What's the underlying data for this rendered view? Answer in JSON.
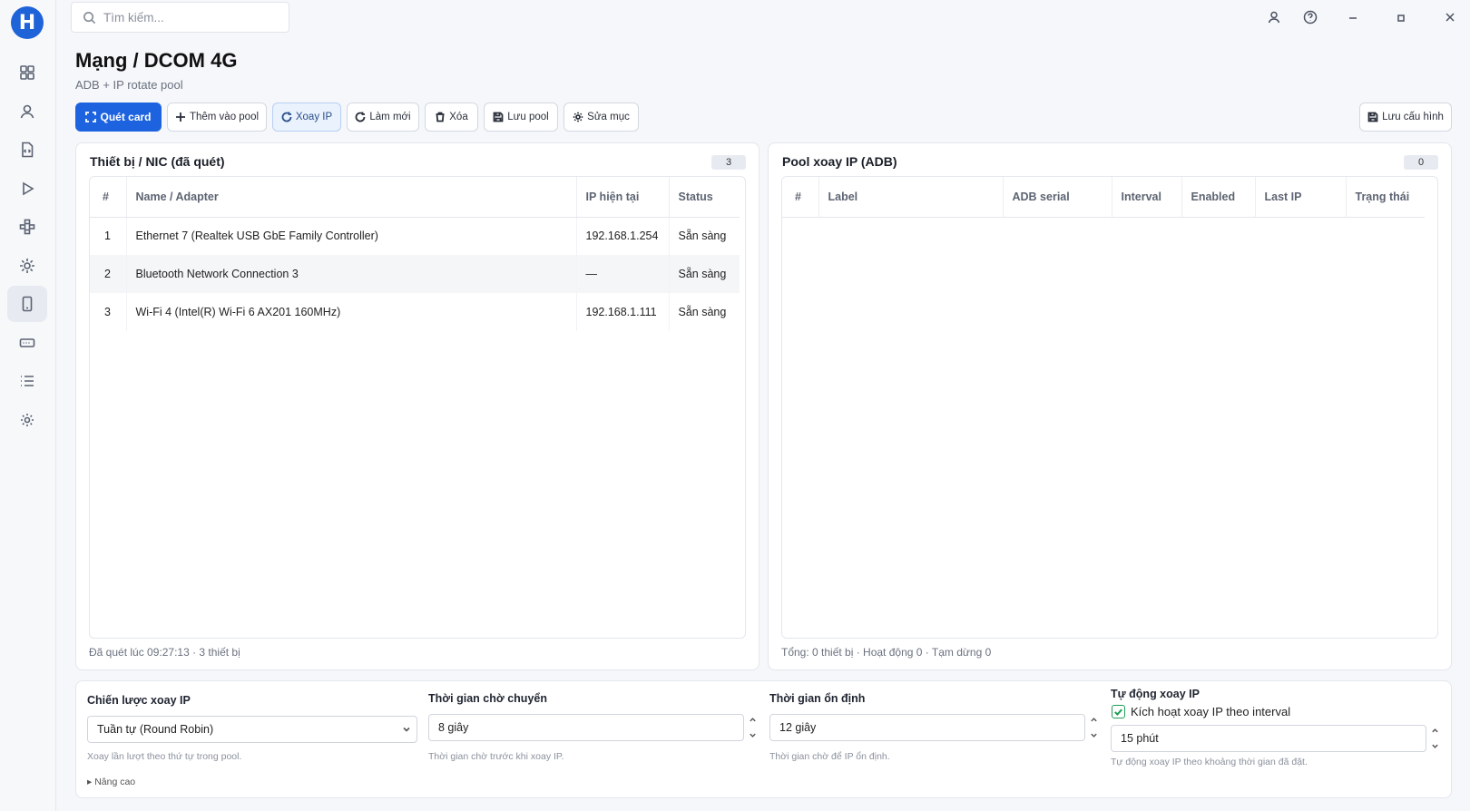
{
  "search": {
    "placeholder": "Tìm kiếm..."
  },
  "page": {
    "title": "Mạng / DCOM 4G",
    "subtitle": "ADB + IP rotate pool"
  },
  "toolbar": {
    "scan_label": "Quét card",
    "add_pool_label": "Thêm vào pool",
    "rotate_label": "Xoay IP",
    "refresh_label": "Làm mới",
    "delete_label": "Xóa",
    "save_pool_label": "Lưu pool",
    "edit_label": "Sửa mục",
    "save_config_label": "Lưu cấu hình"
  },
  "devices": {
    "title": "Thiết bị / NIC (đã quét)",
    "count": "3",
    "columns": [
      "#",
      "Name / Adapter",
      "IP hiện tại",
      "Status"
    ],
    "rows": [
      {
        "index": "1",
        "name": "Ethernet 7 (Realtek USB GbE Family Controller)",
        "ip": "192.168.1.254",
        "status": "Sẵn sàng"
      },
      {
        "index": "2",
        "name": "Bluetooth Network Connection 3",
        "ip": "—",
        "status": "Sẵn sàng"
      },
      {
        "index": "3",
        "name": "Wi-Fi 4 (Intel(R) Wi-Fi 6 AX201 160MHz)",
        "ip": "192.168.1.111",
        "status": "Sẵn sàng"
      }
    ],
    "footer": "Đã quét lúc 09:27:13 · 3 thiết bị"
  },
  "pool": {
    "title": "Pool xoay IP (ADB)",
    "count": "0",
    "columns": [
      "#",
      "Label",
      "ADB serial",
      "Interval",
      "Enabled",
      "Last IP",
      "Trạng thái"
    ],
    "footer": "Tổng: 0 thiết bị · Hoạt động 0 · Tạm dừng 0"
  },
  "settings": {
    "strategy": {
      "label": "Chiến lược xoay IP",
      "value": "Tuần tự (Round Robin)",
      "hint": "Xoay lần lượt theo thứ tự trong pool."
    },
    "wait": {
      "label": "Thời gian chờ chuyển",
      "value": "8 giây",
      "hint": "Thời gian chờ trước khi xoay IP."
    },
    "stable": {
      "label": "Thời gian ổn định",
      "value": "12 giây",
      "hint": "Thời gian chờ để IP ổn định."
    },
    "auto": {
      "label": "Tự động xoay IP",
      "checkbox_label": "Kích hoạt xoay IP theo interval",
      "value": "15 phút",
      "hint": "Tự động xoay IP theo khoảng thời gian đã đặt."
    },
    "advanced_label": "▸ Nâng cao"
  },
  "colors": {
    "primary": "#1d63e0",
    "success": "#1f9d55"
  }
}
